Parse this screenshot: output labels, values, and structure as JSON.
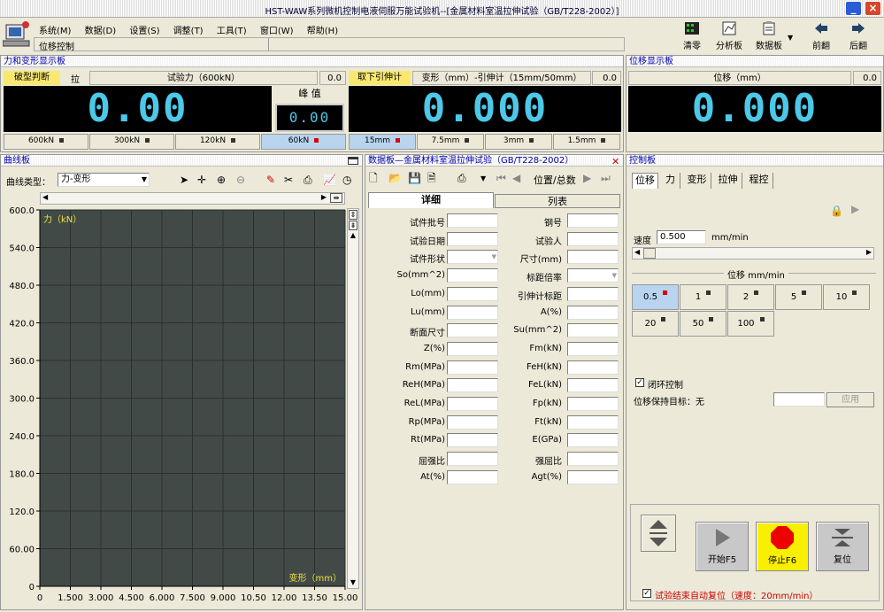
{
  "window": {
    "title": "HST-WAW系列微机控制电液伺服万能试验机--[金属材料室温拉伸试验（GB/T228-2002）]"
  },
  "menu": [
    "系统(M)",
    "数据(D)",
    "设置(S)",
    "调整(T)",
    "工具(T)",
    "窗口(W)",
    "帮助(H)"
  ],
  "status": "位移控制",
  "toolbar": [
    {
      "label": "清零",
      "icon": "grid-icon"
    },
    {
      "label": "分析板",
      "icon": "analysis-icon"
    },
    {
      "label": "数据板",
      "icon": "clipboard-icon"
    },
    {
      "label": "前翻",
      "icon": "back-arrow-icon"
    },
    {
      "label": "后翻",
      "icon": "forward-arrow-icon"
    }
  ],
  "force_panel": {
    "title": "力和变形显示板",
    "mode_btn": "破型判断",
    "mode_val": "拉",
    "force_header": "试验力（600kN）",
    "force_small": "0.0",
    "force_value": "0.00",
    "peak_label": "峰 值",
    "peak_value": "0.00",
    "ranges": [
      "600kN",
      "300kN",
      "120kN",
      "60kN"
    ],
    "selected_range": 3,
    "extens_btn": "取下引伸计",
    "def_header": "变形（mm）-引伸计（15mm/50mm）",
    "def_small": "0.0",
    "def_value": "0.000",
    "def_ranges": [
      "15mm",
      "7.5mm",
      "3mm",
      "1.5mm"
    ],
    "def_selected": 0
  },
  "disp_panel": {
    "title": "位移显示板",
    "header": "位移（mm）",
    "small": "0.0",
    "value": "0.000"
  },
  "curve_panel": {
    "title": "曲线板",
    "type_label": "曲线类型：",
    "type_value": "力-变形",
    "y_label": "力（kN）",
    "x_label": "变形（mm）"
  },
  "chart_data": {
    "type": "line",
    "ylabel": "力（kN）",
    "xlabel": "变形（mm）",
    "ylim": [
      0,
      600
    ],
    "xlim": [
      0,
      15
    ],
    "yticks": [
      "600.0",
      "540.0",
      "480.0",
      "420.0",
      "360.0",
      "300.0",
      "240.0",
      "180.0",
      "120.0",
      "60.00",
      "0"
    ],
    "xticks": [
      "0",
      "1.500",
      "3.000",
      "4.500",
      "6.000",
      "7.500",
      "9.000",
      "10.50",
      "12.00",
      "13.50",
      "15.00"
    ],
    "series": [
      {
        "values": []
      }
    ],
    "grid": true
  },
  "data_panel": {
    "title": "数据板—金属材料室温拉伸试验（GB/T228-2002）",
    "nav_label": "位置/总数",
    "tab_detail": "详细",
    "tab_list": "列表",
    "left_fields": [
      "试件批号",
      "试验日期",
      "试件形状",
      "So(mm^2)",
      "Lo(mm)",
      "Lu(mm)",
      "断面尺寸",
      "Z(%)",
      "Rm(MPa)",
      "ReH(MPa)",
      "ReL(MPa)",
      "Rp(MPa)",
      "Rt(MPa)",
      "屈强比",
      "At(%)"
    ],
    "right_fields": [
      "钢号",
      "试验人",
      "尺寸(mm)",
      "标距倍率",
      "引伸计标距",
      "A(%)",
      "Su(mm^2)",
      "Fm(kN)",
      "FeH(kN)",
      "FeL(kN)",
      "Fp(kN)",
      "Ft(kN)",
      "E(GPa)",
      "强屈比",
      "Agt(%)"
    ]
  },
  "control_panel": {
    "title": "控制板",
    "tabs": [
      "位移",
      "力",
      "变形",
      "拉伸",
      "程控"
    ],
    "speed_label": "速度",
    "speed_value": "0.500",
    "speed_unit": "mm/min",
    "group_label": "位移 mm/min",
    "speeds": [
      "0.5",
      "1",
      "2",
      "5",
      "10",
      "20",
      "50",
      "100"
    ],
    "selected_speed": 0,
    "closed_loop": "闭环控制",
    "hold_label": "位移保持目标：无",
    "apply": "应用",
    "start": "开始F5",
    "stop": "停止F6",
    "reset": "复位",
    "auto_reset": "试验结束自动复位（速度：20mm/min）"
  }
}
